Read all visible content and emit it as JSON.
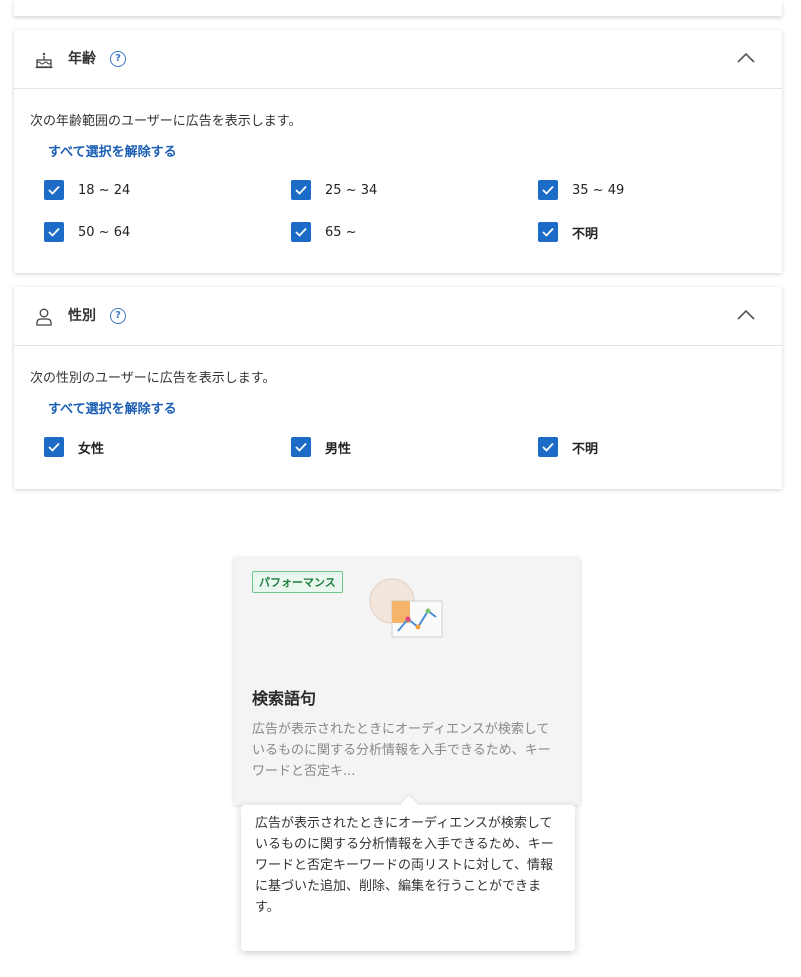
{
  "age_section": {
    "title": "年齢",
    "help": "?",
    "description": "次の年齢範囲のユーザーに広告を表示します。",
    "clear_link": "すべて選択を解除する",
    "options": [
      {
        "label": "18 ~ 24",
        "checked": true
      },
      {
        "label": "25 ~ 34",
        "checked": true
      },
      {
        "label": "35 ~ 49",
        "checked": true
      },
      {
        "label": "50 ~ 64",
        "checked": true
      },
      {
        "label": "65 ~",
        "checked": true
      },
      {
        "label": "不明",
        "checked": true
      }
    ]
  },
  "gender_section": {
    "title": "性別",
    "help": "?",
    "description": "次の性別のユーザーに広告を表示します。",
    "clear_link": "すべて選択を解除する",
    "options": [
      {
        "label": "女性",
        "checked": true
      },
      {
        "label": "男性",
        "checked": true
      },
      {
        "label": "不明",
        "checked": true
      }
    ]
  },
  "card": {
    "badge": "パフォーマンス",
    "title": "検索語句",
    "description": "広告が表示されたときにオーディエンスが検索しているものに関する分析情報を入手できるため、キーワードと否定キ..."
  },
  "tooltip": {
    "text": "広告が表示されたときにオーディエンスが検索しているものに関する分析情報を入手できるため、キーワードと否定キーワードの両リストに対して、情報に基づいた追加、削除、編集を行うことができます。"
  },
  "colors": {
    "accent": "#1c6bc6",
    "link": "#1b5fb5",
    "badge_green": "#1e7d3f"
  }
}
